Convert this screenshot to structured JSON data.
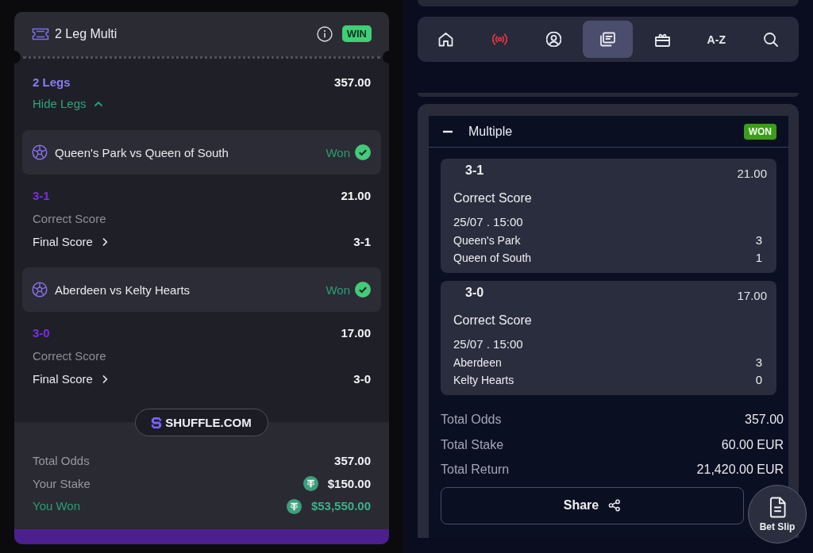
{
  "left_bet": {
    "title": "2 Leg Multi",
    "result_badge": "WIN",
    "legs_count": "2 Legs",
    "header_odds": "357.00",
    "toggle": {
      "label": "Hide Legs",
      "expanded": true
    },
    "legs": [
      {
        "match": "Queen's Park vs Queen of South",
        "status": "Won",
        "pick": "3-1",
        "odds": "21.00",
        "market": "Correct Score",
        "final_label": "Final Score",
        "final_score": "3-1"
      },
      {
        "match": "Aberdeen vs Kelty Hearts",
        "status": "Won",
        "pick": "3-0",
        "odds": "17.00",
        "market": "Correct Score",
        "final_label": "Final Score",
        "final_score": "3-0"
      }
    ],
    "brand": "SHUFFLE.COM",
    "summary": [
      {
        "kind": "plain",
        "label": "Total Odds",
        "value": "357.00"
      },
      {
        "kind": "stake",
        "label": "Your Stake",
        "value": "$150.00"
      },
      {
        "kind": "win",
        "label": "You Won",
        "value": "$53,550.00"
      }
    ]
  },
  "nav": [
    {
      "kind": "icon",
      "selected": false
    },
    {
      "kind": "icon",
      "selected": false
    },
    {
      "kind": "icon",
      "selected": false
    },
    {
      "kind": "icon",
      "selected": true
    },
    {
      "kind": "icon",
      "selected": false
    },
    {
      "kind": "text",
      "label": "A-Z",
      "selected": false
    },
    {
      "kind": "icon",
      "selected": false
    }
  ],
  "right_bet": {
    "expanded": true,
    "title": "Multiple",
    "result_badge": "WON",
    "selections": [
      {
        "pick": "3-1",
        "odds": "21.00",
        "market": "Correct Score",
        "datetime": "25/07 . 15:00",
        "teams": [
          {
            "name": "Queen's Park",
            "score": "3"
          },
          {
            "name": "Queen of South",
            "score": "1"
          }
        ]
      },
      {
        "pick": "3-0",
        "odds": "17.00",
        "market": "Correct Score",
        "datetime": "25/07 . 15:00",
        "teams": [
          {
            "name": "Aberdeen",
            "score": "3"
          },
          {
            "name": "Kelty Hearts",
            "score": "0"
          }
        ]
      }
    ],
    "totals": [
      {
        "label": "Total Odds",
        "value": "357.00"
      },
      {
        "label": "Total Stake",
        "value": "60.00 EUR"
      },
      {
        "label": "Total Return",
        "value": "21,420.00 EUR"
      }
    ],
    "share_button": "Share"
  },
  "bet_slip_button": "Bet Slip"
}
